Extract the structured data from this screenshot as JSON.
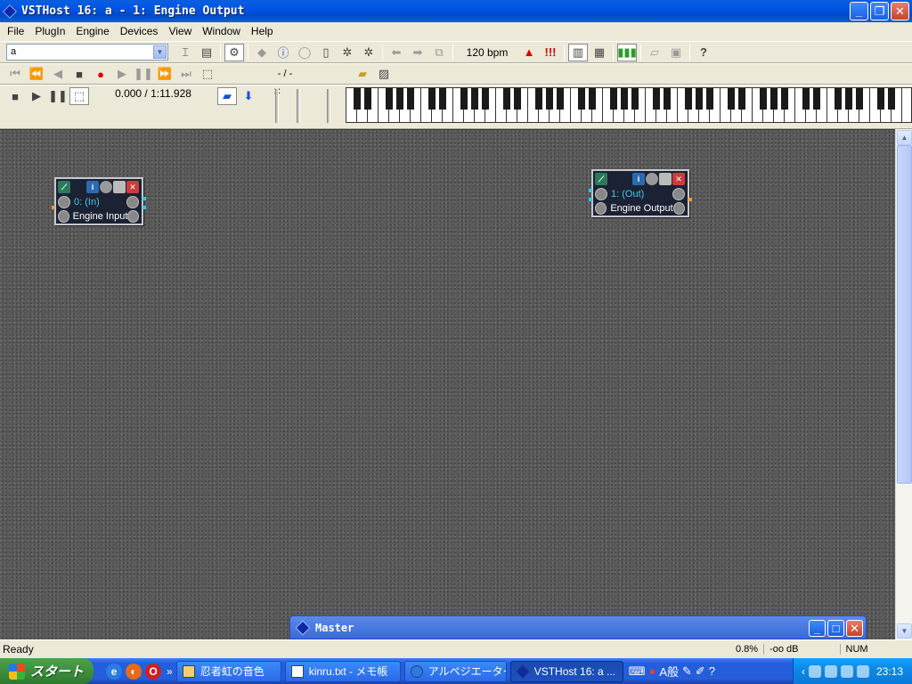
{
  "window": {
    "title": "VSTHost 16: a - 1: Engine Output",
    "minimize": "_",
    "maximize": "❐",
    "close": "✕"
  },
  "menu": [
    "File",
    "PlugIn",
    "Engine",
    "Devices",
    "View",
    "Window",
    "Help"
  ],
  "toolbar": {
    "bank_combo_value": "a",
    "bpm": "120 bpm",
    "position": "- / -",
    "time": "0.000 / 1:11.928"
  },
  "nodes": {
    "input": {
      "channel": "0: (In)",
      "name": "Engine Input"
    },
    "output": {
      "channel": "1: (Out)",
      "name": "Engine Output"
    }
  },
  "master": {
    "title": "Master"
  },
  "status": {
    "ready": "Ready",
    "cpu": "0.8%",
    "level": "-oo dB",
    "num": "NUM"
  },
  "taskbar": {
    "start": "スタート",
    "tasks": [
      "忍者虹の音色",
      "kinru.txt - メモ帳",
      "アルペジエーター...",
      "VSTHost 16: a ..."
    ],
    "ime": "A般",
    "clock": "23:13"
  }
}
